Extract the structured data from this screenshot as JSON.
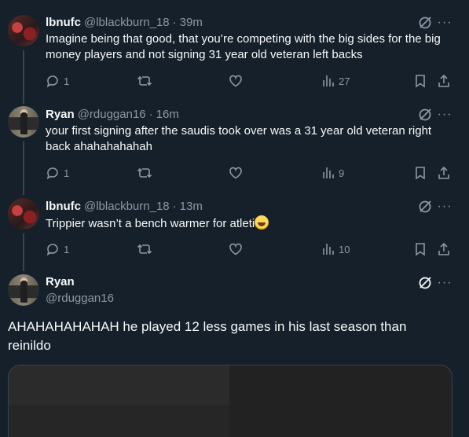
{
  "colors": {
    "background": "#15202b",
    "text_primary": "#f7f9f9",
    "text_secondary": "#8b98a5",
    "divider": "#38444d"
  },
  "replies": [
    {
      "name": "lbnufc",
      "handle": "@lblackburn_18",
      "separator": "·",
      "time": "39m",
      "text": "Imagine being that good, that you’re competing with the big sides for the big money players and not signing 31 year old veteran left backs",
      "reply_count": "1",
      "retweet_count": "",
      "like_count": "",
      "view_count": "27",
      "avatar": "lbnufc-avatar"
    },
    {
      "name": "Ryan",
      "handle": "@rduggan16",
      "separator": "·",
      "time": "16m",
      "text": "your first signing after the saudis took over was a 31 year old veteran right back ahahahahahah",
      "reply_count": "1",
      "retweet_count": "",
      "like_count": "",
      "view_count": "9",
      "avatar": "ryan-avatar"
    },
    {
      "name": "lbnufc",
      "handle": "@lblackburn_18",
      "separator": "·",
      "time": "13m",
      "text": "Trippier wasn’t a bench warmer for atleti",
      "emoji": "rolling-on-floor-laughing-emoji",
      "reply_count": "1",
      "retweet_count": "",
      "like_count": "",
      "view_count": "10",
      "avatar": "lbnufc-avatar"
    }
  ],
  "main_post": {
    "name": "Ryan",
    "handle": "@rduggan16",
    "text": "AHAHAHAHAHAH he played 12 less games in his last season than reinildo",
    "avatar": "ryan-avatar"
  },
  "icons": {
    "grok": "grok-icon",
    "more": "more-icon",
    "reply": "reply-icon",
    "retweet": "retweet-icon",
    "like": "like-icon",
    "views": "views-icon",
    "bookmark": "bookmark-icon",
    "share": "share-icon"
  },
  "more_glyph": "···"
}
